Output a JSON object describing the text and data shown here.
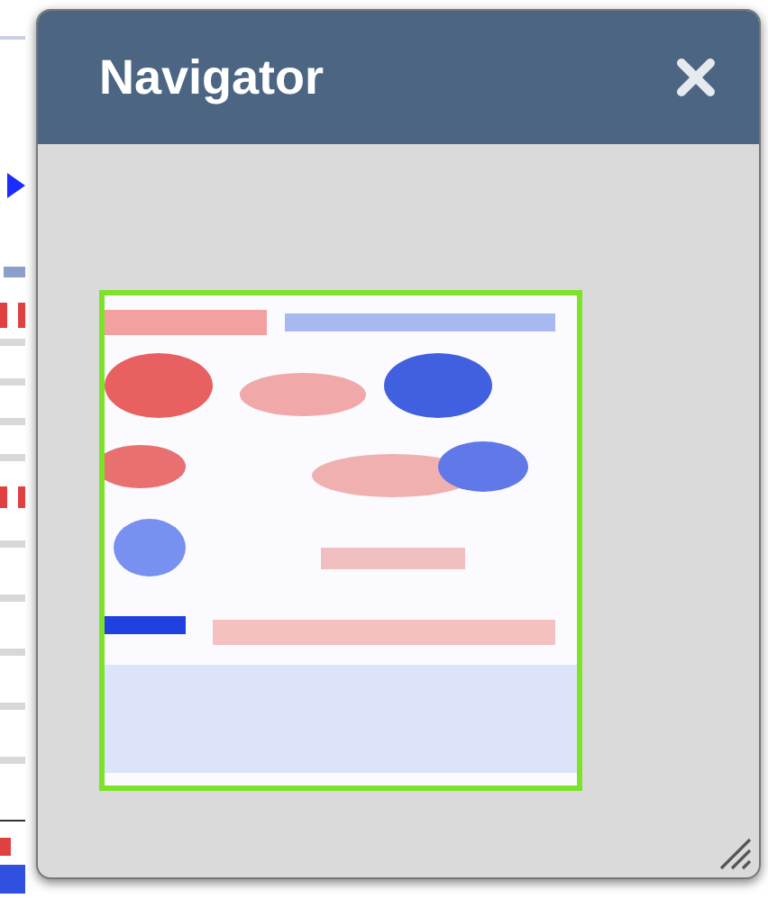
{
  "window": {
    "title": "Navigator"
  }
}
